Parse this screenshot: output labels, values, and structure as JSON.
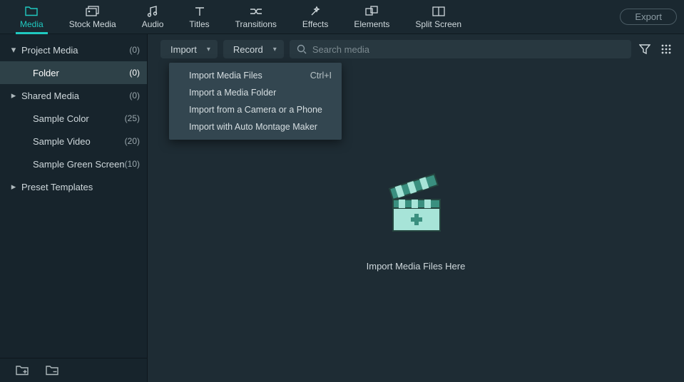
{
  "nav": {
    "media": "Media",
    "stock": "Stock Media",
    "audio": "Audio",
    "titles": "Titles",
    "transitions": "Transitions",
    "effects": "Effects",
    "elements": "Elements",
    "split": "Split Screen",
    "export": "Export"
  },
  "sidebar": {
    "items": [
      {
        "label": "Project Media",
        "count": "(0)",
        "expandable": true,
        "expanded": true
      },
      {
        "label": "Folder",
        "count": "(0)",
        "indent": true,
        "selected": true
      },
      {
        "label": "Shared Media",
        "count": "(0)",
        "expandable": true
      },
      {
        "label": "Sample Color",
        "count": "(25)",
        "indent": true
      },
      {
        "label": "Sample Video",
        "count": "(20)",
        "indent": true
      },
      {
        "label": "Sample Green Screen",
        "count": "(10)",
        "indent": true
      },
      {
        "label": "Preset Templates",
        "count": "",
        "expandable": true
      }
    ]
  },
  "toolbar": {
    "import": "Import",
    "record": "Record",
    "search_placeholder": "Search media"
  },
  "menu": {
    "items": [
      {
        "label": "Import Media Files",
        "shortcut": "Ctrl+I"
      },
      {
        "label": "Import a Media Folder",
        "shortcut": ""
      },
      {
        "label": "Import from a Camera or a Phone",
        "shortcut": ""
      },
      {
        "label": "Import with Auto Montage Maker",
        "shortcut": ""
      }
    ]
  },
  "dropzone": {
    "caption": "Import Media Files Here"
  }
}
